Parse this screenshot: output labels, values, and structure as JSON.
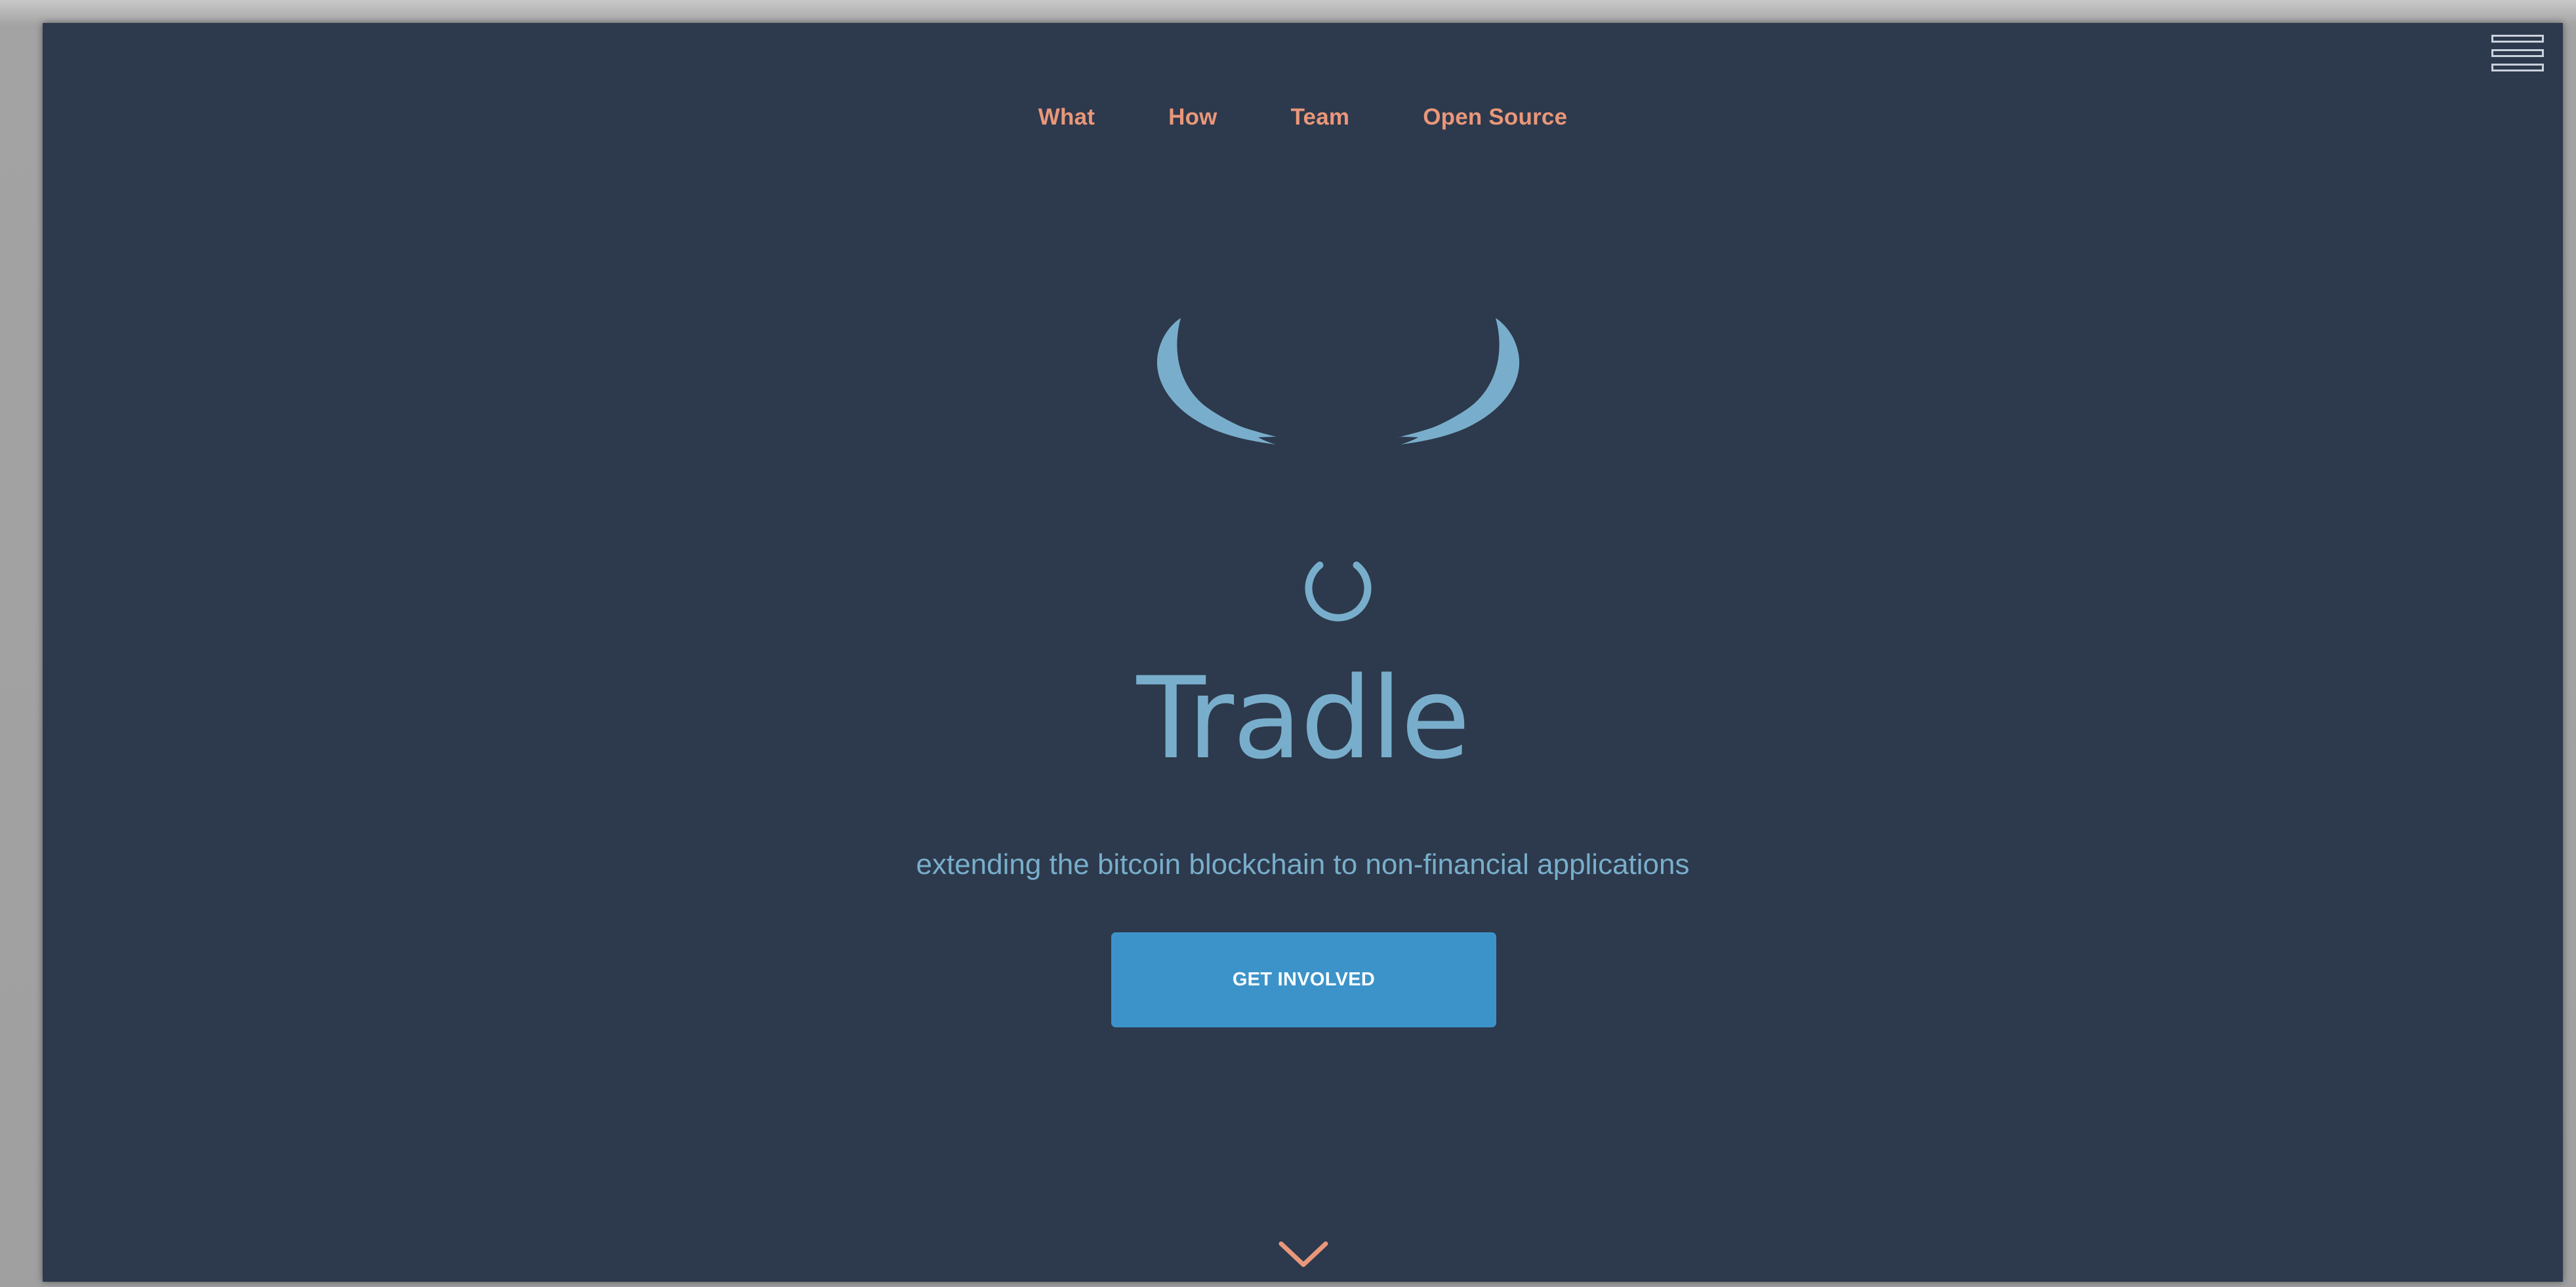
{
  "nav": {
    "items": [
      {
        "label": "What"
      },
      {
        "label": "How"
      },
      {
        "label": "Team"
      },
      {
        "label": "Open Source"
      }
    ]
  },
  "menu": {
    "icon": "hamburger-menu-icon"
  },
  "hero": {
    "logo_icon": "bull-horns-ring-icon",
    "title": "Tradle",
    "subtitle": "extending the bitcoin blockchain to non-financial applications",
    "cta_label": "GET INVOLVED",
    "scroll_icon": "chevron-down-icon"
  },
  "colors": {
    "background": "#2d394c",
    "accent": "#e9977a",
    "logo": "#78aecb",
    "button": "#3c93c9",
    "button_text": "#ffffff",
    "outer_frame": "#a2a2a2"
  }
}
